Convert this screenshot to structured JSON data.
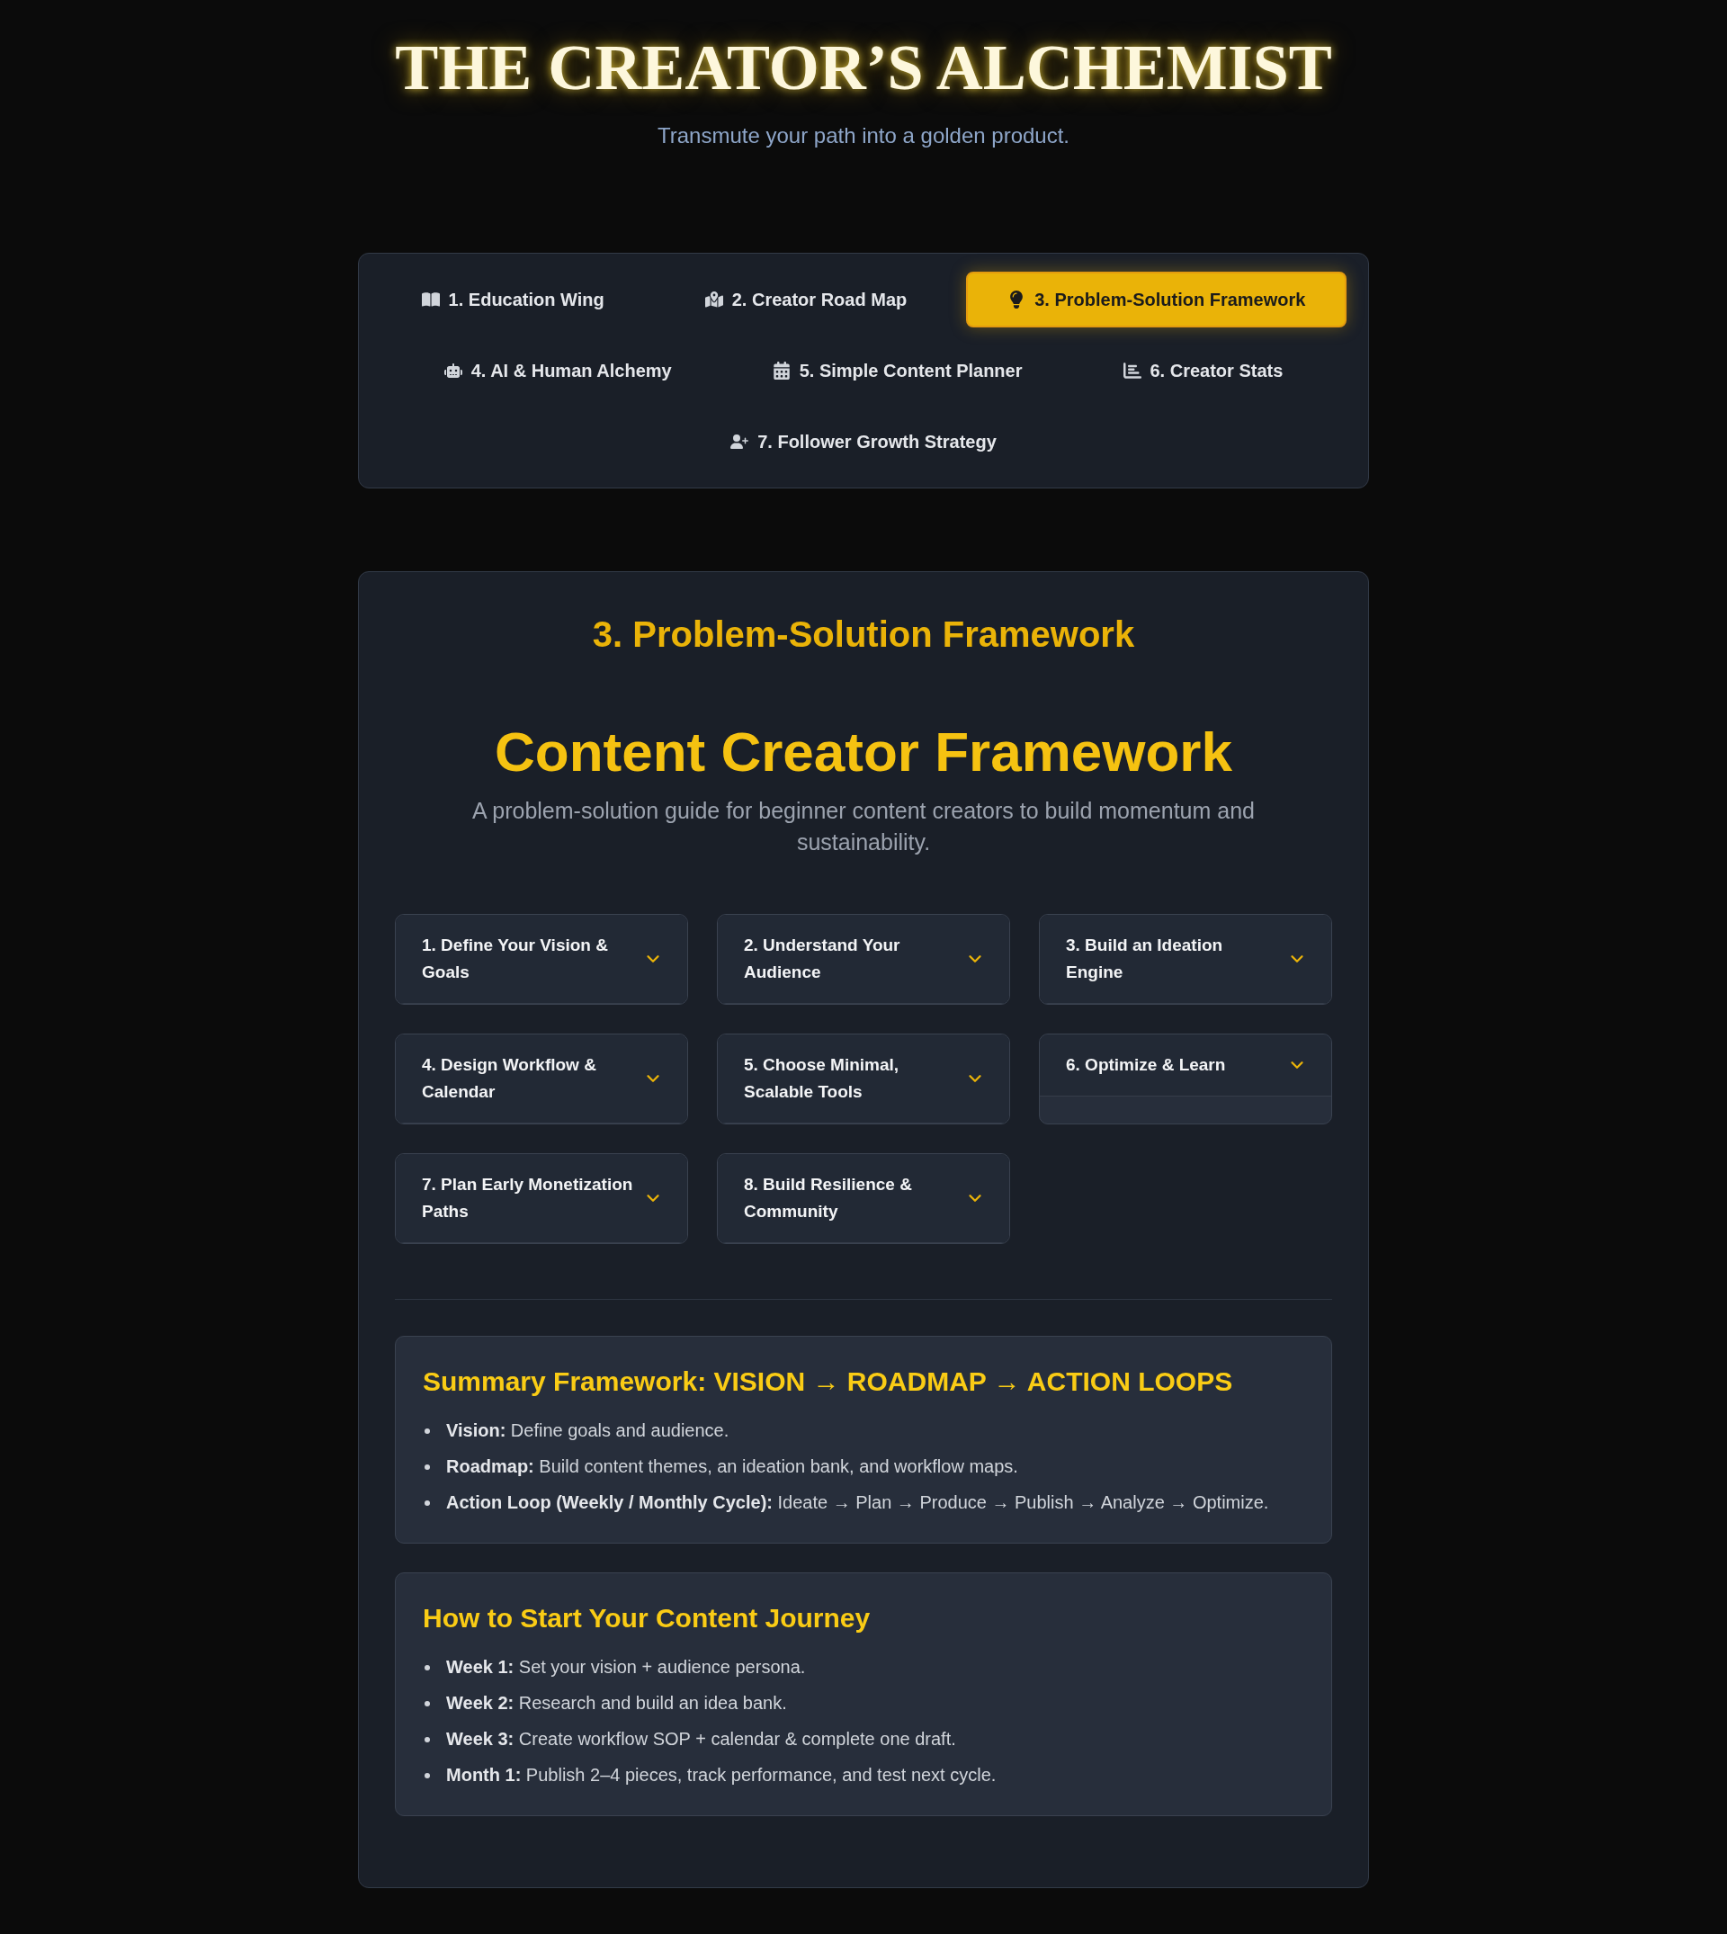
{
  "header": {
    "title": "THE CREATOR’S ALCHEMIST",
    "subtitle": "Transmute your path into a golden product."
  },
  "tabs": [
    {
      "label": "1. Education Wing",
      "selected": false
    },
    {
      "label": "2. Creator Road Map",
      "selected": false
    },
    {
      "label": "3. Problem-Solution Framework",
      "selected": true
    },
    {
      "label": "4. AI & Human Alchemy",
      "selected": false
    },
    {
      "label": "5. Simple Content Planner",
      "selected": false
    },
    {
      "label": "6. Creator Stats",
      "selected": false
    },
    {
      "label": "7. Follower Growth Strategy",
      "selected": false
    }
  ],
  "section": {
    "heading": "3. Problem-Solution Framework",
    "title": "Content Creator Framework",
    "description": "A problem-solution guide for beginner content creators to build momentum and sustainability.",
    "steps": [
      {
        "title": "1. Define Your Vision & Goals",
        "expanded": false
      },
      {
        "title": "2. Understand Your Audience",
        "expanded": false
      },
      {
        "title": "3. Build an Ideation Engine",
        "expanded": false
      },
      {
        "title": "4. Design Workflow & Calendar",
        "expanded": false
      },
      {
        "title": "5. Choose Minimal, Scalable Tools",
        "expanded": false
      },
      {
        "title": "6. Optimize & Learn",
        "expanded": false
      },
      {
        "title": "7. Plan Early Monetization Paths",
        "expanded": false
      },
      {
        "title": "8. Build Resilience & Community",
        "expanded": false
      }
    ],
    "summary": {
      "heading": "Summary Framework: VISION → ROADMAP → ACTION LOOPS",
      "items": [
        "**Vision:** Define goals and audience.",
        "**Roadmap:** Build content themes, an ideation bank, and workflow maps.",
        "**Action Loop (Weekly / Monthly Cycle):** Ideate → Plan → Produce → Publish → Analyze → Optimize."
      ]
    },
    "start_guide": {
      "heading": "How to Start Your Content Journey",
      "items": [
        "**Week 1:** Set your vision + audience persona.",
        "**Week 2:** Research and build an idea bank.",
        "**Week 3:** Create workflow SOP + calendar & complete one draft.",
        "**Month 1:** Publish 2–4 pieces, track performance, and test next cycle."
      ]
    }
  }
}
